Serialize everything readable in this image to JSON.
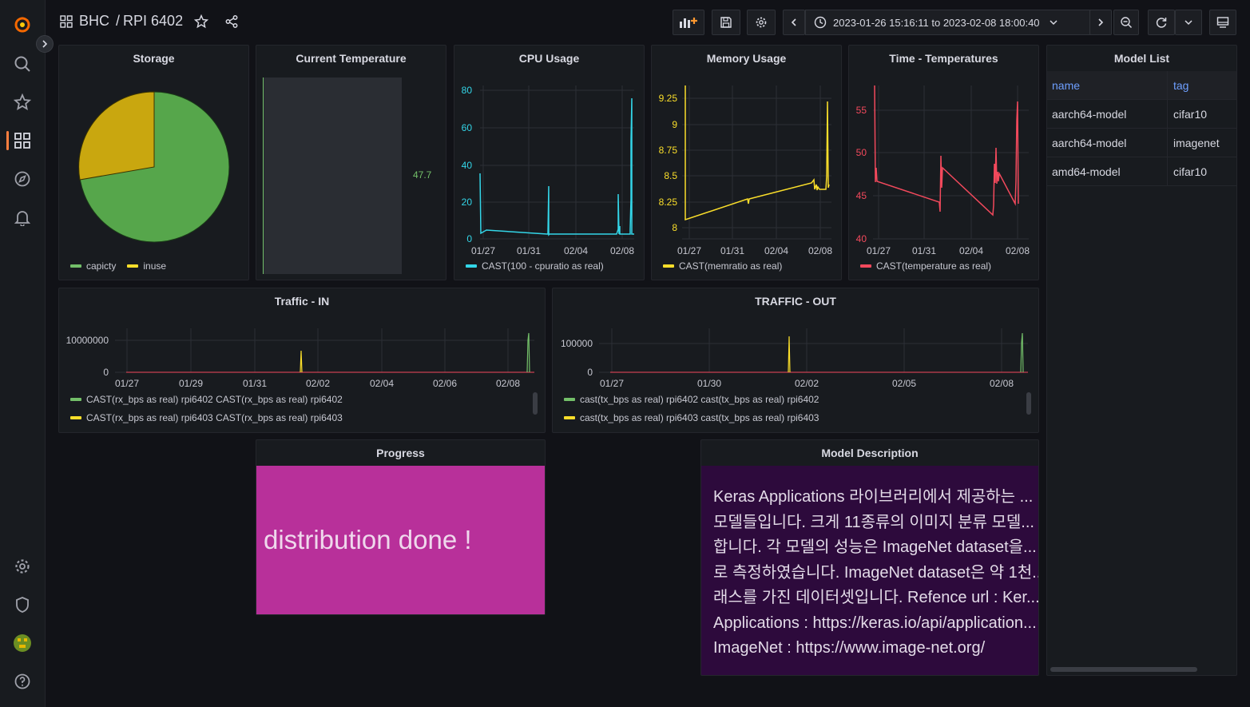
{
  "breadcrumb": {
    "folder": "BHC",
    "separator": "/",
    "dashboard": "RPI 6402"
  },
  "time_range": "2023-01-26 15:16:11 to 2023-02-08 18:00:40",
  "colors": {
    "green": "#73bf69",
    "yellow": "#fade2a",
    "cyan": "#33d6e8",
    "red": "#f2495c",
    "olive": "#c9a70f",
    "magenta": "#b8309a",
    "purple": "#2d0a3c",
    "link": "#6e9fff"
  },
  "panels": {
    "storage": {
      "title": "Storage",
      "legend": [
        "capicty",
        "inuse"
      ]
    },
    "temperature": {
      "title": "Current Temperature",
      "value": "47.7"
    },
    "cpu": {
      "title": "CPU Usage",
      "legend": "CAST(100 - cpuratio as real)",
      "y_ticks": [
        "80",
        "60",
        "40",
        "20",
        "0"
      ],
      "x_ticks": [
        "01/27",
        "01/31",
        "02/04",
        "02/08"
      ]
    },
    "memory": {
      "title": "Memory Usage",
      "legend": "CAST(memratio as real)",
      "y_ticks": [
        "9.25",
        "9",
        "8.75",
        "8.5",
        "8.25",
        "8"
      ],
      "x_ticks": [
        "01/27",
        "01/31",
        "02/04",
        "02/08"
      ]
    },
    "temps": {
      "title": "Time - Temperatures",
      "legend": "CAST(temperature as real)",
      "y_ticks": [
        "55",
        "50",
        "45",
        "40"
      ],
      "x_ticks": [
        "01/27",
        "01/31",
        "02/04",
        "02/08"
      ]
    },
    "models": {
      "title": "Model List",
      "headers": [
        "name",
        "tag"
      ],
      "rows": [
        [
          "aarch64-model",
          "cifar10"
        ],
        [
          "aarch64-model",
          "imagenet"
        ],
        [
          "amd64-model",
          "cifar10"
        ]
      ]
    },
    "traffic_in": {
      "title": "Traffic - IN",
      "y_ticks": [
        "10000000",
        "0"
      ],
      "x_ticks": [
        "01/27",
        "01/29",
        "01/31",
        "02/02",
        "02/04",
        "02/06",
        "02/08"
      ],
      "legend": [
        "CAST(rx_bps as real) rpi6402 CAST(rx_bps as real) rpi6402",
        "CAST(rx_bps as real) rpi6403 CAST(rx_bps as real) rpi6403"
      ]
    },
    "traffic_out": {
      "title": "TRAFFIC - OUT",
      "y_ticks": [
        "100000",
        "0"
      ],
      "x_ticks": [
        "01/27",
        "01/30",
        "02/02",
        "02/05",
        "02/08"
      ],
      "legend": [
        "cast(tx_bps as real) rpi6402 cast(tx_bps as real) rpi6402",
        "cast(tx_bps as real) rpi6403 cast(tx_bps as real) rpi6403"
      ]
    },
    "progress": {
      "title": "Progress",
      "text": "distribution done !"
    },
    "description": {
      "title": "Model Description",
      "lines": [
        "Keras Applications 라이브러리에서 제공하는 ...",
        "모델들입니다. 크게 11종류의 이미지 분류 모델...",
        "합니다. 각 모델의 성능은 ImageNet dataset을...",
        "로 측정하였습니다. ImageNet dataset은 약 1천...",
        "래스를 가진 데이터셋입니다. Refence url : Ker...",
        "Applications : https://keras.io/api/application...",
        "ImageNet : https://www.image-net.org/"
      ]
    }
  }
}
